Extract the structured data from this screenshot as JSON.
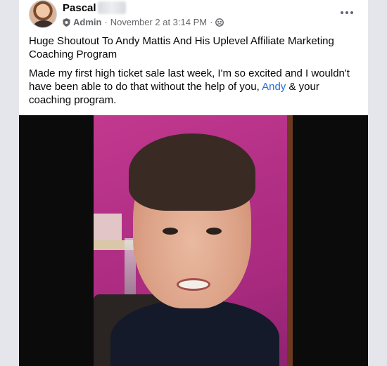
{
  "post": {
    "author_name": "Pascal",
    "role": "Admin",
    "timestamp": "November 2 at 3:14 PM",
    "separator": "·",
    "title": "Huge Shoutout To Andy Mattis And His Uplevel Affiliate Marketing Coaching Program",
    "body_before_mention": "Made my first high ticket sale last week, I'm so excited and I wouldn't have been able to do that without the help of you, ",
    "mention": "Andy",
    "body_after_mention": " & your coaching program."
  },
  "icons": {
    "badge": "admin-shield-icon",
    "audience": "group-audience-icon",
    "more": "more-options-icon"
  },
  "colors": {
    "mention": "#216fdb",
    "meta_text": "#65676b",
    "video_bg": "#0b0b0b",
    "wall": "#b22f86"
  }
}
